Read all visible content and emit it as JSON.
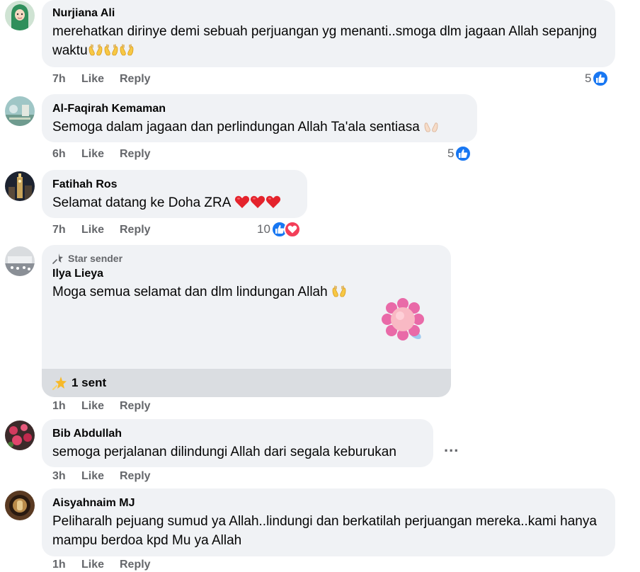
{
  "comments": [
    {
      "author": "Nurjiana Ali",
      "text": "merehatkan dirinye demi sebuah perjuangan yg menanti..smoga dlm jagaan Allah sepanjng waktu",
      "time": "7h",
      "like": "Like",
      "reply": "Reply",
      "reaction_count": "5",
      "reaction_icons": [
        "like-icon"
      ],
      "trailing_emoji": [
        "palms-up-together-emoji",
        "palms-up-together-emoji",
        "palms-up-together-emoji"
      ]
    },
    {
      "author": "Al-Faqirah Kemaman",
      "text": "Semoga dalam jagaan dan perlindungan Allah Ta'ala sentiasa",
      "time": "6h",
      "like": "Like",
      "reply": "Reply",
      "reaction_count": "5",
      "reaction_icons": [
        "like-icon"
      ],
      "trailing_emoji": [
        "palms-up-together-emoji"
      ]
    },
    {
      "author": "Fatihah Ros",
      "text": "Selamat datang ke Doha ZRA",
      "time": "7h",
      "like": "Like",
      "reply": "Reply",
      "reaction_count": "10",
      "reaction_icons": [
        "like-icon",
        "love-icon"
      ],
      "trailing_emoji": [
        "red-heart-emoji",
        "red-heart-emoji",
        "red-heart-emoji"
      ]
    },
    {
      "badge": "Star sender",
      "author": "Ilya Lieya",
      "text": "Moga semua selamat dan dlm lindungan Allah",
      "sticker": "pink-flower-sticker",
      "stars_sent": "1 sent",
      "time": "1h",
      "like": "Like",
      "reply": "Reply",
      "trailing_emoji": [
        "palms-up-together-emoji"
      ]
    },
    {
      "author": "Bib Abdullah",
      "text": "semoga perjalanan dilindungi Allah dari segala keburukan",
      "time": "3h",
      "like": "Like",
      "reply": "Reply",
      "more": "..."
    },
    {
      "author": "Aisyahnaim MJ",
      "text": "Peliharalh pejuang sumud ya Allah..lindungi dan berkatilah perjuangan mereka..kami hanya mampu berdoa kpd Mu ya Allah",
      "time": "1h",
      "like": "Like",
      "reply": "Reply"
    }
  ],
  "colors": {
    "bubble": "#f0f2f5",
    "secondary_text": "#65676b",
    "like_blue": "#1877f2",
    "love_red": "#f33e58"
  }
}
